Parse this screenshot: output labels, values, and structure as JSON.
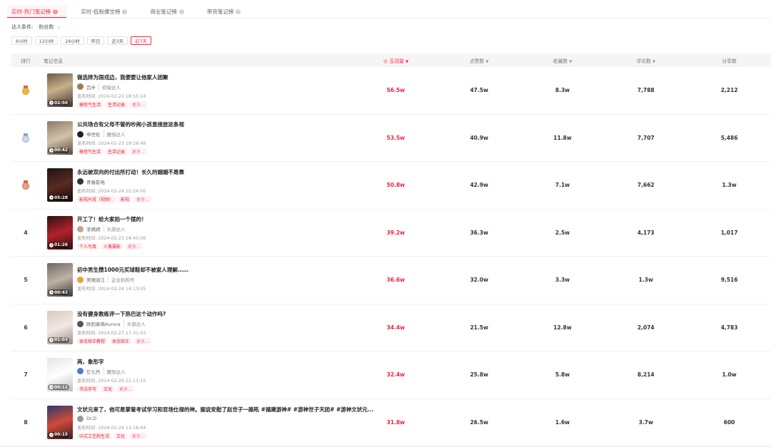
{
  "tabs": [
    {
      "label": "实时-热门笔记榜",
      "active": true
    },
    {
      "label": "实时-低粉爆文榜",
      "active": false
    },
    {
      "label": "商业笔记榜",
      "active": false
    },
    {
      "label": "带货笔记榜",
      "active": false
    }
  ],
  "condition": {
    "label": "达人条件:",
    "selected": "粉丝数"
  },
  "time_filters": [
    "6小时",
    "12小时",
    "24小时",
    "昨日",
    "近3天",
    "近7天"
  ],
  "time_active": "近7天",
  "columns": {
    "rank": "排行",
    "note": "笔记信息",
    "interaction": "互动量",
    "likes": "点赞数",
    "collects": "收藏数",
    "comments": "评论数",
    "shares": "分享数"
  },
  "more_label": "更多...",
  "date_prefix": "发布时间:",
  "rows": [
    {
      "rank": "1",
      "title": "做选择为国戎边，我便要让他家人团聚",
      "author": "吕半",
      "level": "初级达人",
      "date": "2024-02-23 18:55:24",
      "duration": "02:50",
      "tags": [
        "搞怪气生活",
        "生活记录"
      ],
      "interaction": "56.5w",
      "likes": "47.5w",
      "collects": "8.3w",
      "comments": "7,788",
      "shares": "2,212"
    },
    {
      "rank": "2",
      "title": "公共场合有父母不管的吵闹小孩直接放这条视",
      "author": "申世伦",
      "level": "腰部达人",
      "date": "2024-02-23 19:18:48",
      "duration": "00:42",
      "tags": [
        "搞怪气生活",
        "生活记录"
      ],
      "interaction": "53.5w",
      "likes": "40.9w",
      "collects": "11.8w",
      "comments": "7,707",
      "shares": "5,486"
    },
    {
      "rank": "3",
      "title": "永远被双向的付出所打动！长久的姻姻不是靠",
      "author": "青春影电",
      "level": "",
      "date": "2024-02-24 15:24:00",
      "duration": "05:28",
      "tags": [
        "影视片段（视频）",
        "影视"
      ],
      "interaction": "50.8w",
      "likes": "42.9w",
      "collects": "7.1w",
      "comments": "7,662",
      "shares": "1.3w"
    },
    {
      "rank": "4",
      "title": "开工了！给大家拍一个摆的！",
      "author": "李嫣嫣",
      "level": "头部达人",
      "date": "2024-02-23 18:40:06",
      "duration": "01:26",
      "tags": [
        "个人写真",
        "人像摄影"
      ],
      "interaction": "39.2w",
      "likes": "36.3w",
      "collects": "2.5w",
      "comments": "4,173",
      "shares": "1,017"
    },
    {
      "rank": "5",
      "title": "初中男生攒1000元买球鞋却不被家人理解……",
      "author": "美丽浙江",
      "level": "企业机构号",
      "date": "2024-02-24 14:13:05",
      "duration": "00:43",
      "tags": [],
      "interaction": "36.6w",
      "likes": "32.0w",
      "collects": "3.3w",
      "comments": "1.3w",
      "shares": "9,516"
    },
    {
      "rank": "6",
      "title": "没有健身教练评一下热巴这个动作吗?",
      "author": "欧阳春晓Aurora",
      "level": "头部达人",
      "date": "2024-02-27 17:31:03",
      "duration": "01:03",
      "tags": [
        "体态矫正教程",
        "体态矫正"
      ],
      "interaction": "34.4w",
      "likes": "21.5w",
      "collects": "12.8w",
      "comments": "2,074",
      "shares": "4,783"
    },
    {
      "rank": "7",
      "title": "两，象形字",
      "author": "忆七丹",
      "level": "腰部达人",
      "date": "2024-02-26 22:11:15",
      "duration": "00:12",
      "tags": [
        "书法手写",
        "文化"
      ],
      "interaction": "32.4w",
      "likes": "25.8w",
      "collects": "5.8w",
      "comments": "8,214",
      "shares": "1.0w"
    },
    {
      "rank": "8",
      "title": "文状元来了，他可是掌管考试学习和官场仕禄的神。据说安慰了赵世子一路吼 #福建游神# #游神世子天团# #游神文状元...",
      "author": "Dr.D",
      "level": "",
      "date": "2024-02-24 13:18:44",
      "duration": "00:15",
      "tags": [
        "中式工艺和生活",
        "文化"
      ],
      "interaction": "31.8w",
      "likes": "26.5w",
      "collects": "1.6w",
      "comments": "3.7w",
      "shares": "600"
    }
  ]
}
